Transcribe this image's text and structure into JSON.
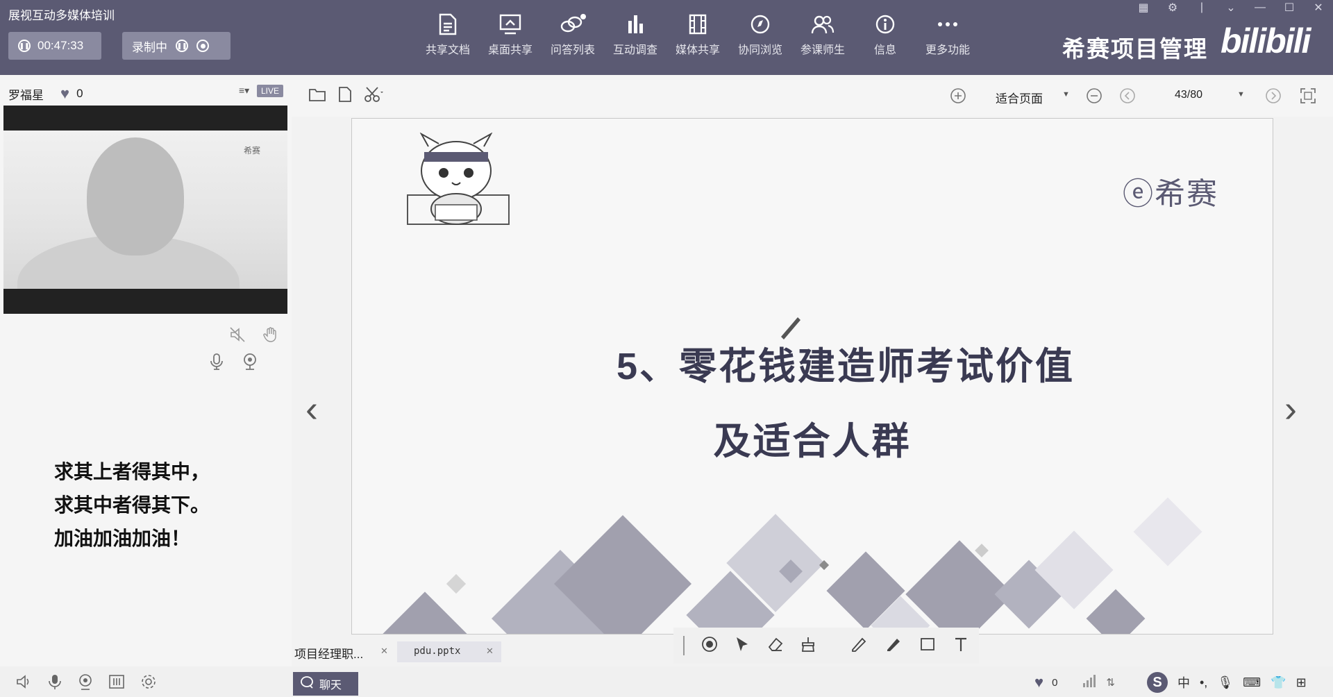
{
  "app": {
    "title": "展视互动多媒体培训"
  },
  "recording": {
    "timer": "00:47:33",
    "status_label": "录制中"
  },
  "toolbar": {
    "items": [
      {
        "label": "共享文档",
        "icon": "document-share-icon"
      },
      {
        "label": "桌面共享",
        "icon": "desktop-share-icon"
      },
      {
        "label": "问答列表",
        "icon": "qa-chat-icon"
      },
      {
        "label": "互动调查",
        "icon": "bar-chart-icon"
      },
      {
        "label": "媒体共享",
        "icon": "film-icon"
      },
      {
        "label": "协同浏览",
        "icon": "compass-icon"
      },
      {
        "label": "参课师生",
        "icon": "users-icon"
      },
      {
        "label": "信息",
        "icon": "info-icon"
      },
      {
        "label": "更多功能",
        "icon": "more-icon"
      }
    ]
  },
  "brand": {
    "name": "希赛项目管理",
    "watermark": "bilibili"
  },
  "presenter": {
    "name": "罗福星",
    "likes": "0",
    "live_badge": "LIVE",
    "video_logo": "希赛"
  },
  "quote": {
    "line1": "求其上者得其中，",
    "line2": "求其中者得其下。",
    "line3": "加油加油加油！"
  },
  "doc_toolbar": {
    "fit_label": "适合页面",
    "page_indicator": "43/80"
  },
  "slide": {
    "logo_text": "希赛",
    "title_line1": "5、零花钱建造师考试价值",
    "title_line2": "及适合人群",
    "accent_color": "#5b5a73"
  },
  "tabs": {
    "tab1_label": "项目经理职...",
    "tab2_label": "pdu.pptx"
  },
  "bottom": {
    "chat_label": "聊天",
    "likes": "0",
    "ime_label": "中"
  }
}
